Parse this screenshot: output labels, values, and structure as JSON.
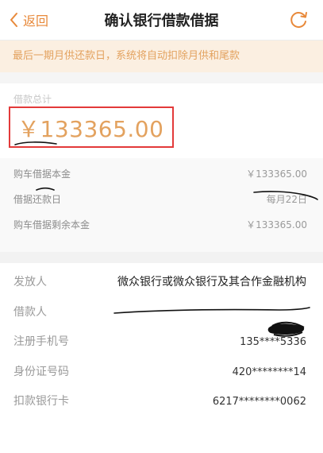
{
  "header": {
    "back_label": "返回",
    "title": "确认银行借款借据"
  },
  "notice": {
    "text": "最后一期月供还款日，系统将自动扣除月供和尾款"
  },
  "total": {
    "label": "借款总计",
    "amount": "￥133365.00"
  },
  "details": [
    {
      "label": "购车借据本金",
      "value": "￥133365.00"
    },
    {
      "label": "借据还款日",
      "value": "每月22日"
    },
    {
      "label": "购车借据剩余本金",
      "value": "￥133365.00"
    }
  ],
  "info": [
    {
      "label": "发放人",
      "value": "微众银行或微众银行及其合作金融机构"
    },
    {
      "label": "借款人",
      "value": ""
    },
    {
      "label": "注册手机号",
      "value": "135****5336"
    },
    {
      "label": "身份证号码",
      "value": "420********14"
    },
    {
      "label": "扣款银行卡",
      "value": "6217********0062"
    }
  ],
  "colors": {
    "accent": "#e8893a",
    "amount": "#e3a25f",
    "notice_bg": "#fbefe1",
    "highlight_box": "#e33a3a"
  },
  "icons": {
    "back": "chevron-left-icon",
    "refresh": "refresh-icon"
  }
}
